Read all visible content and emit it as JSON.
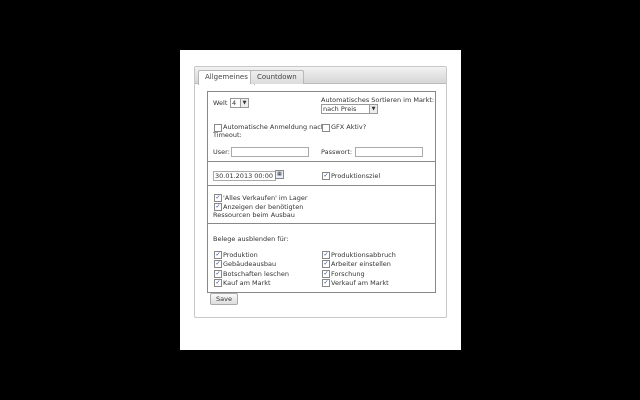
{
  "tabs": [
    {
      "label": "Allgemeines",
      "active": true
    },
    {
      "label": "Countdown",
      "active": false
    }
  ],
  "general": {
    "welt_label": "Welt",
    "welt_value": "4",
    "sort_label": "Automatisches Sortieren im Markt:",
    "sort_value": "nach Preis",
    "auto_login_label": "Automatische Anmeldung nach Timeout:",
    "auto_login_line1": "Automatische Anmeldung nach",
    "auto_login_line2": "Timeout:",
    "auto_login_checked": false,
    "gfx_label": "GFX Aktiv?",
    "gfx_checked": false,
    "user_label": "User:",
    "user_value": "",
    "password_label": "Passwort:",
    "password_value": ""
  },
  "production": {
    "date_value": "30.01.2013 00:00",
    "goal_label": "Produktionsziel",
    "goal_checked": true
  },
  "market": {
    "sell_all_label": "'Alles Verkaufen' im Lager",
    "sell_all_checked": true,
    "show_resources_line1": "Anzeigen der benötigten",
    "show_resources_line2": "Ressourcen beim Ausbau",
    "show_resources_checked": true
  },
  "hide": {
    "title": "Belege ausblenden für:",
    "left": [
      {
        "label": "Produktion",
        "checked": true
      },
      {
        "label": "Gebäudeausbau",
        "checked": true
      },
      {
        "label": "Botschaften leschen",
        "checked": true
      },
      {
        "label": "Kauf am Markt",
        "checked": true
      }
    ],
    "right": [
      {
        "label": "Produktionsabbruch",
        "checked": true
      },
      {
        "label": "Arbeiter einstellen",
        "checked": true
      },
      {
        "label": "Forschung",
        "checked": true
      },
      {
        "label": "Verkauf am Markt",
        "checked": true
      }
    ]
  },
  "save_label": "Save",
  "icons": {
    "check": "checkmark-icon",
    "dropdown": "chevron-down-icon",
    "calendar": "calendar-icon"
  },
  "colors": {
    "background": "#000000",
    "panel": "#ffffff",
    "check": "#1a3c8c"
  }
}
